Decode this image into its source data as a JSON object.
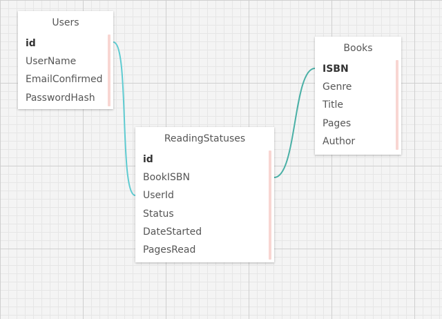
{
  "colors": {
    "connector_users": "#5ecbd1",
    "connector_books": "#4ab0a6",
    "scrollbar": "#f8d6d2"
  },
  "tables": {
    "users": {
      "title": "Users",
      "fields": [
        "id",
        "UserName",
        "EmailConfirmed",
        "PasswordHash"
      ]
    },
    "books": {
      "title": "Books",
      "fields": [
        "ISBN",
        "Genre",
        "Title",
        "Pages",
        "Author"
      ]
    },
    "reading_statuses": {
      "title": "ReadingStatuses",
      "fields": [
        "id",
        "BookISBN",
        "UserId",
        "Status",
        "DateStarted",
        "PagesRead"
      ]
    }
  }
}
